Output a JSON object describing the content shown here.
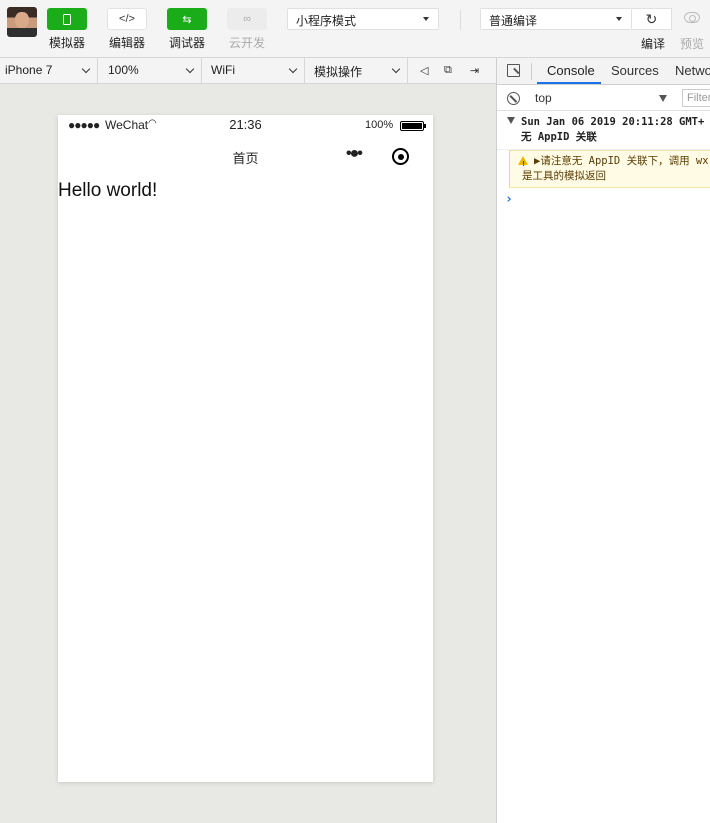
{
  "toolbar": {
    "simulator_label": "模拟器",
    "editor_label": "编辑器",
    "debugger_label": "调试器",
    "cloud_label": "云开发",
    "editor_glyph": "</>",
    "debugger_glyph": "⇆",
    "cloud_glyph": "∞",
    "mode_select": "小程序模式",
    "compile_select": "普通编译",
    "compile_label": "编译",
    "preview_label": "预览",
    "refresh_glyph": "↻"
  },
  "device_bar": {
    "device": "iPhone 7",
    "zoom": "100%",
    "network": "WiFi",
    "simulate_ops": "模拟操作",
    "sound_glyph": "◁",
    "window_glyph": "⧉",
    "dock_glyph": "⇥"
  },
  "phone": {
    "signal": "●●●●●",
    "carrier": "WeChat",
    "wifi_glyph": "◠",
    "time": "21:36",
    "battery_pct": "100%",
    "nav_title": "首页",
    "more_glyph": "•●•",
    "content_text": "Hello world!"
  },
  "devtools": {
    "tabs": [
      "Console",
      "Sources",
      "Network"
    ],
    "context": "top",
    "filter_placeholder": "Filter",
    "log_group_line1": "Sun Jan 06 2019 20:11:28 GMT+",
    "log_group_line2": "无 AppID 关联",
    "warn_line1": "▶请注意无 AppID 关联下，调用 wx",
    "warn_line2": "是工具的模拟返回",
    "prompt": "›"
  }
}
